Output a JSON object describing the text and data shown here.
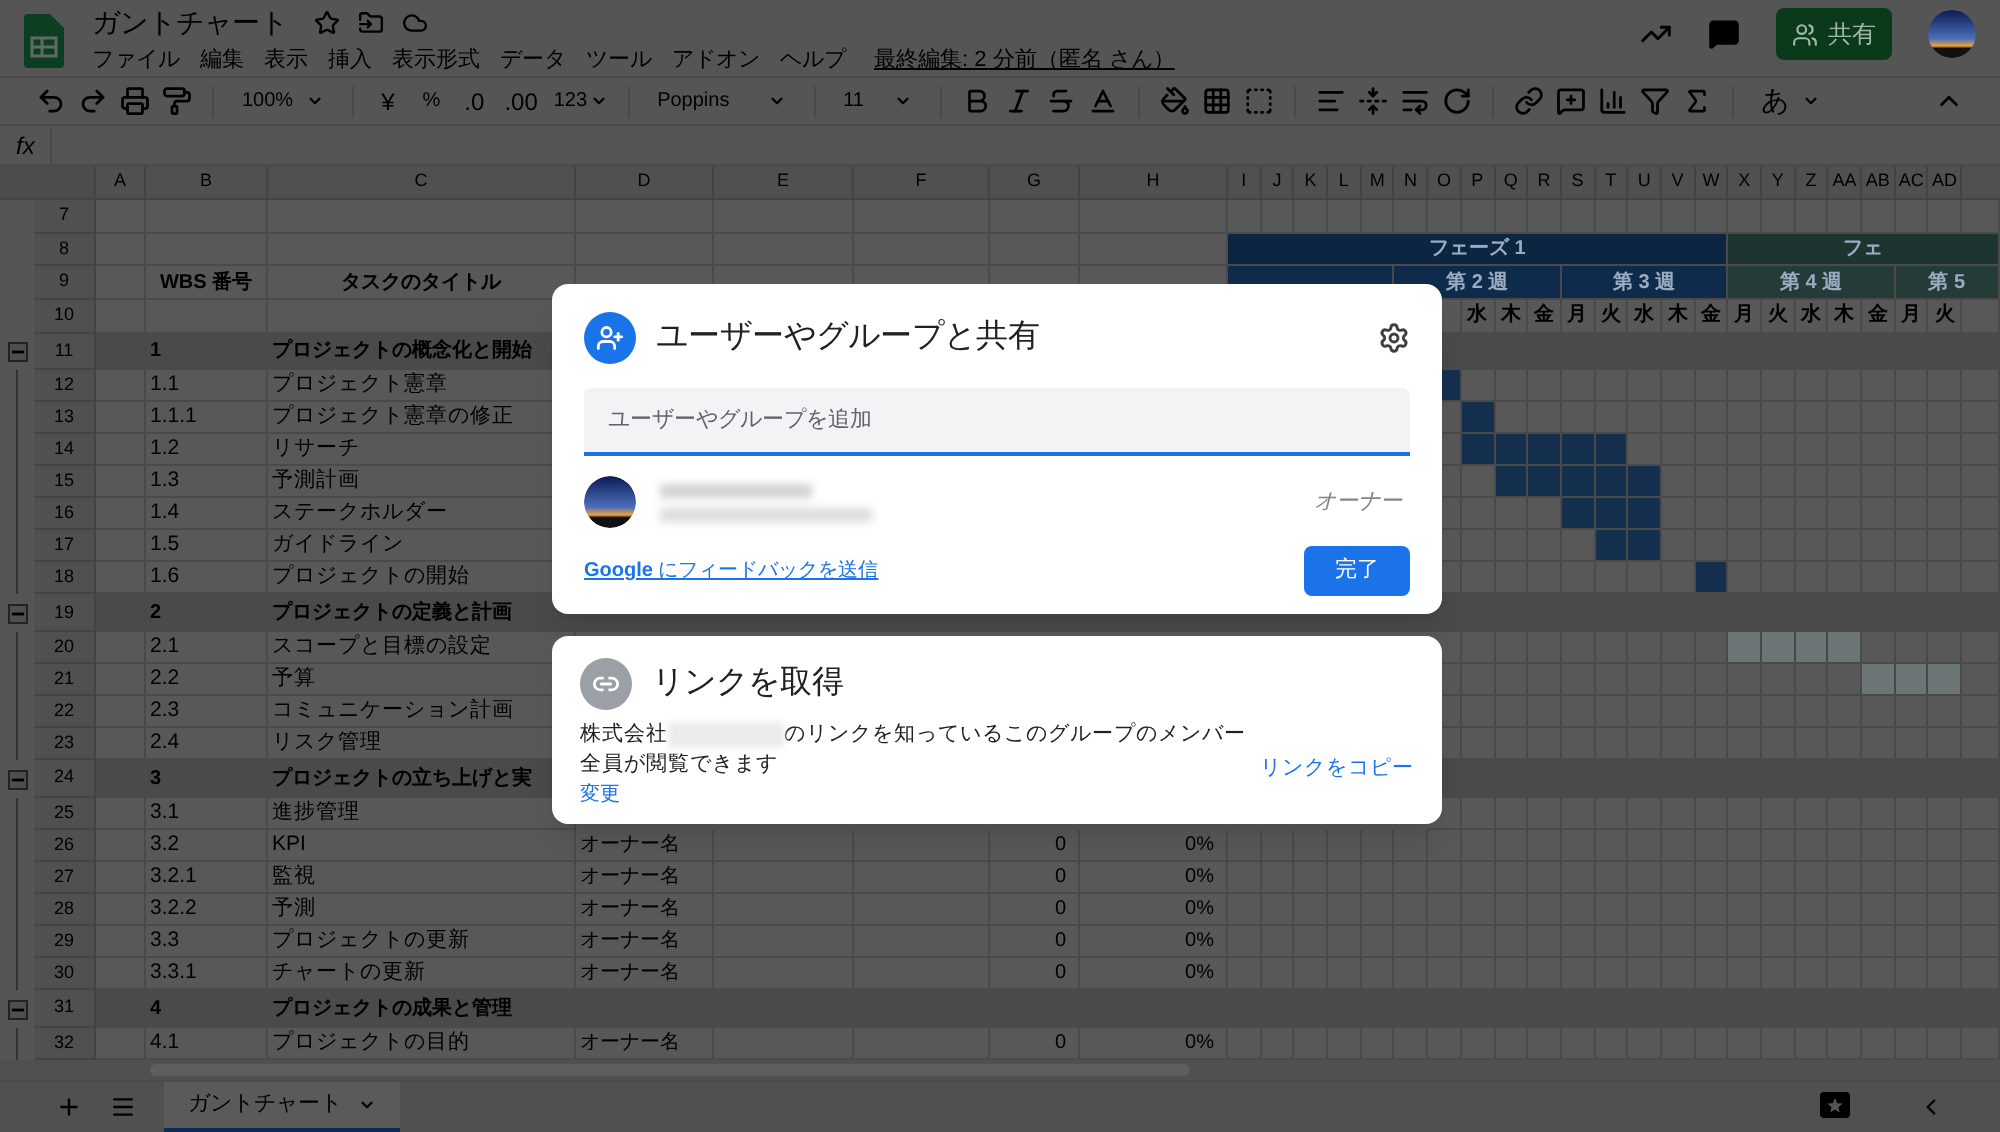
{
  "app": {
    "title": "ガントチャート",
    "menu": [
      "ファイル",
      "編集",
      "表示",
      "挿入",
      "表示形式",
      "データ",
      "ツール",
      "アドオン",
      "ヘルプ"
    ],
    "last_edit": "最終編集: 2 分前（匿名 さん）",
    "share_button": "共有"
  },
  "toolbar": {
    "zoom": "100%",
    "currency": "¥",
    "percent": "%",
    "decrease_decimals": ".0",
    "increase_decimals": ".00",
    "more_formats": "123",
    "font": "Poppins",
    "font_size": "11",
    "input_tools": "あ"
  },
  "formula_bar": {
    "label": "fx"
  },
  "columns": [
    "A",
    "B",
    "C",
    "D",
    "E",
    "F",
    "G",
    "H",
    "I",
    "J",
    "K",
    "L",
    "M",
    "N",
    "O",
    "P",
    "Q",
    "R",
    "S",
    "T",
    "U",
    "V",
    "W",
    "X",
    "Y",
    "Z",
    "AA",
    "AB",
    "AC",
    "AD"
  ],
  "rows": [
    {
      "number": "7",
      "kind": "blank"
    },
    {
      "number": "8",
      "kind": "phases",
      "phases": [
        {
          "label": "フェーズ 1",
          "color": "#0b2542"
        },
        {
          "label": "フェ",
          "color": "#1d3431"
        }
      ]
    },
    {
      "number": "9",
      "kind": "heading",
      "wbs": "WBS 番号",
      "title": "タスクのタイトル",
      "weeks": [
        {
          "label": "第 2 週",
          "color": "#0e2b4c"
        },
        {
          "label": "第 3 週",
          "color": "#0e2b4c"
        },
        {
          "label": "第 4 週",
          "color": "#253b37"
        },
        {
          "label": "第 5",
          "color": "#253b37"
        }
      ]
    },
    {
      "number": "10",
      "kind": "days",
      "days": [
        "水",
        "木",
        "金",
        "月",
        "火",
        "水",
        "木",
        "金",
        "月",
        "火",
        "水",
        "木",
        "金",
        "月",
        "火"
      ]
    },
    {
      "number": "11",
      "kind": "phase",
      "expanded": true,
      "wbs": "1",
      "title": "プロジェクトの概念化と開始"
    },
    {
      "number": "12",
      "kind": "task",
      "wbs": "1.1",
      "title": "プロジェクト憲章",
      "color": "#15304f",
      "filled": [
        true,
        false,
        false,
        false,
        false,
        false,
        false,
        false,
        false,
        false,
        false,
        false,
        false,
        false,
        false,
        false
      ]
    },
    {
      "number": "13",
      "kind": "task",
      "wbs": "1.1.1",
      "title": "プロジェクト憲章の修正",
      "color": "#15304f",
      "filled": [
        false,
        true,
        false,
        false,
        false,
        false,
        false,
        false,
        false,
        false,
        false,
        false,
        false,
        false,
        false,
        false
      ]
    },
    {
      "number": "14",
      "kind": "task",
      "wbs": "1.2",
      "title": "リサーチ",
      "color": "#15304f",
      "filled": [
        false,
        true,
        true,
        true,
        true,
        true,
        false,
        false,
        false,
        false,
        false,
        false,
        false,
        false,
        false,
        false
      ]
    },
    {
      "number": "15",
      "kind": "task",
      "wbs": "1.3",
      "title": "予測計画",
      "color": "#15304f",
      "filled": [
        false,
        false,
        true,
        true,
        true,
        true,
        true,
        false,
        false,
        false,
        false,
        false,
        false,
        false,
        false,
        false
      ]
    },
    {
      "number": "16",
      "kind": "task",
      "wbs": "1.4",
      "title": "ステークホルダー",
      "color": "#15304f",
      "filled": [
        false,
        false,
        false,
        false,
        true,
        true,
        true,
        false,
        false,
        false,
        false,
        false,
        false,
        false,
        false,
        false
      ]
    },
    {
      "number": "17",
      "kind": "task",
      "wbs": "1.5",
      "title": "ガイドライン",
      "color": "#15304f",
      "filled": [
        false,
        false,
        false,
        false,
        false,
        true,
        true,
        false,
        false,
        false,
        false,
        false,
        false,
        false,
        false,
        false
      ]
    },
    {
      "number": "18",
      "kind": "task",
      "wbs": "1.6",
      "title": "プロジェクトの開始",
      "color": "#15304f",
      "filled": [
        false,
        false,
        false,
        false,
        false,
        false,
        false,
        false,
        true,
        false,
        false,
        false,
        false,
        false,
        false,
        false
      ]
    },
    {
      "number": "19",
      "kind": "phase",
      "expanded": true,
      "wbs": "2",
      "title": "プロジェクトの定義と計画"
    },
    {
      "number": "20",
      "kind": "task",
      "wbs": "2.1",
      "title": "スコープと目標の設定",
      "color": "#6b7575",
      "filled": [
        false,
        false,
        false,
        false,
        false,
        false,
        false,
        false,
        false,
        true,
        true,
        true,
        true,
        false,
        false,
        false
      ]
    },
    {
      "number": "21",
      "kind": "task",
      "wbs": "2.2",
      "title": "予算",
      "color": "#6b7575",
      "filled": [
        false,
        false,
        false,
        false,
        false,
        false,
        false,
        false,
        false,
        false,
        false,
        false,
        false,
        true,
        true,
        true
      ]
    },
    {
      "number": "22",
      "kind": "task",
      "wbs": "2.3",
      "title": "コミュニケーション計画"
    },
    {
      "number": "23",
      "kind": "task",
      "wbs": "2.4",
      "title": "リスク管理"
    },
    {
      "number": "24",
      "kind": "phase",
      "expanded": true,
      "wbs": "3",
      "title": "プロジェクトの立ち上げと実"
    },
    {
      "number": "25",
      "kind": "task",
      "wbs": "3.1",
      "title": "進捗管理"
    },
    {
      "number": "26",
      "kind": "task",
      "wbs": "3.2",
      "title": "KPI",
      "column_d": "オーナー名",
      "column_g": "0",
      "column_h": "0%"
    },
    {
      "number": "27",
      "kind": "task",
      "wbs": "3.2.1",
      "title": "監視",
      "column_d": "オーナー名",
      "column_g": "0",
      "column_h": "0%"
    },
    {
      "number": "28",
      "kind": "task",
      "wbs": "3.2.2",
      "title": "予測",
      "column_d": "オーナー名",
      "column_g": "0",
      "column_h": "0%"
    },
    {
      "number": "29",
      "kind": "task",
      "wbs": "3.3",
      "title": "プロジェクトの更新",
      "column_d": "オーナー名",
      "column_g": "0",
      "column_h": "0%"
    },
    {
      "number": "30",
      "kind": "task",
      "wbs": "3.3.1",
      "title": "チャートの更新",
      "column_d": "オーナー名",
      "column_g": "0",
      "column_h": "0%"
    },
    {
      "number": "31",
      "kind": "phase",
      "expanded": true,
      "wbs": "4",
      "title": "プロジェクトの成果と管理"
    },
    {
      "number": "32",
      "kind": "task",
      "wbs": "4.1",
      "title": "プロジェクトの目的",
      "column_d": "オーナー名",
      "column_g": "0",
      "column_h": "0%"
    }
  ],
  "sheet_tabs": [
    {
      "label": "ガントチャート",
      "selected": true
    }
  ],
  "share_dialog": {
    "title": "ユーザーやグループと共有",
    "add_field": {
      "placeholder": "ユーザーやグループを追加"
    },
    "owner_role": "オーナー",
    "feedback_link": "**Google** にフィードバックを送信",
    "done_button": "完了"
  },
  "link_dialog": {
    "title": "リンクを取得",
    "description_before": "株式会社",
    "description_after": "のリンクを知っているこのグループのメンバー全員が閲覧できます",
    "change_link": "変更",
    "copy_link": "リンクをコピー"
  }
}
